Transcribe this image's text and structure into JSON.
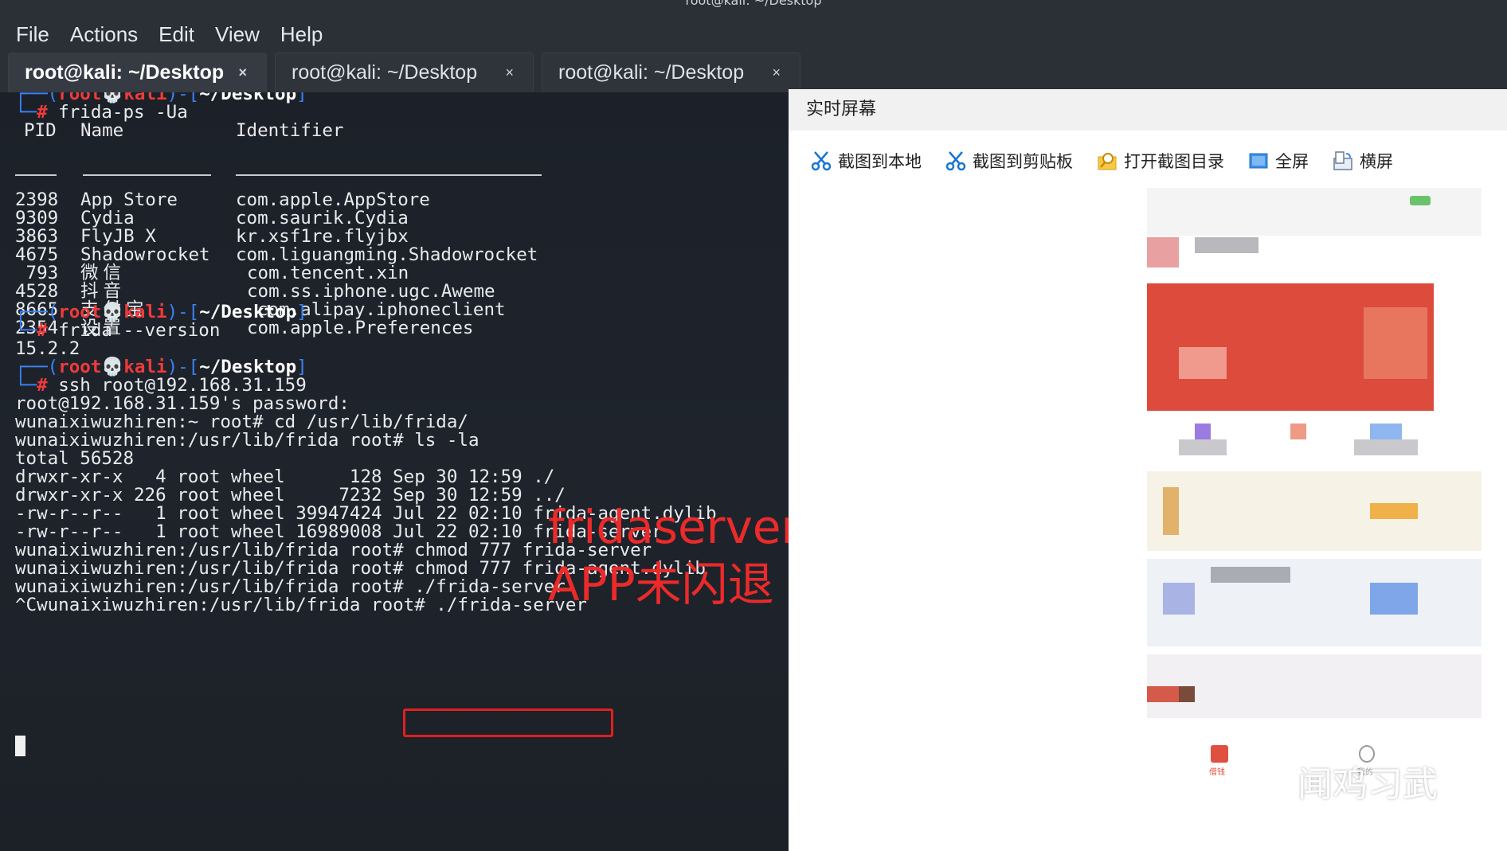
{
  "window": {
    "title": "root@kali: ~/Desktop"
  },
  "menu": [
    "File",
    "Actions",
    "Edit",
    "View",
    "Help"
  ],
  "tabs": [
    {
      "label": "root@kali: ~/Desktop",
      "close": "×"
    },
    {
      "label": "root@kali: ~/Desktop",
      "close": "×"
    },
    {
      "label": "root@kali: ~/Desktop",
      "close": "×"
    }
  ],
  "terminal": {
    "prompt": {
      "user": "root",
      "host": "kali",
      "path": "~/Desktop"
    },
    "cmd1": "frida-ps -Ua",
    "table_headers": {
      "pid": "PID",
      "name": "Name",
      "identifier": "Identifier"
    },
    "processes": [
      {
        "pid": "2398",
        "name": "App Store",
        "id": "com.apple.AppStore"
      },
      {
        "pid": "9309",
        "name": "Cydia",
        "id": "com.saurik.Cydia"
      },
      {
        "pid": "3863",
        "name": "FlyJB X",
        "id": "kr.xsf1re.flyjbx"
      },
      {
        "pid": "4675",
        "name": "Shadowrocket",
        "id": "com.liguangming.Shadowrocket"
      },
      {
        "pid": " 793",
        "name": "微信",
        "id": "com.tencent.xin"
      },
      {
        "pid": "4528",
        "name": "抖音",
        "id": "com.ss.iphone.ugc.Aweme"
      },
      {
        "pid": "8665",
        "name": "支付宝",
        "id": "com.alipay.iphoneclient"
      },
      {
        "pid": "2354",
        "name": "设置",
        "id": "com.apple.Preferences"
      }
    ],
    "cmd2": "frida --version",
    "version": "15.2.2",
    "cmd3": "ssh root@192.168.31.159",
    "lines": [
      "root@192.168.31.159's password:",
      "wunaixiwuzhiren:~ root# cd /usr/lib/frida/",
      "wunaixiwuzhiren:/usr/lib/frida root# ls -la",
      "total 56528",
      "drwxr-xr-x   4 root wheel      128 Sep 30 12:59 ./",
      "drwxr-xr-x 226 root wheel     7232 Sep 30 12:59 ../",
      "-rw-r--r--   1 root wheel 39947424 Jul 22 02:10 frida-agent.dylib",
      "-rw-r--r--   1 root wheel 16989008 Jul 22 02:10 frida-server",
      "wunaixiwuzhiren:/usr/lib/frida root# chmod 777 frida-server",
      "wunaixiwuzhiren:/usr/lib/frida root# chmod 777 frida-agent.dylib",
      "wunaixiwuzhiren:/usr/lib/frida root# ./frida-server",
      "^Cwunaixiwuzhiren:/usr/lib/frida root# ./frida-server"
    ],
    "annotation": "fridaserver运行\nAPP未闪退"
  },
  "mirror": {
    "title": "实时屏幕",
    "toolbar": [
      "截图到本地",
      "截图到剪贴板",
      "打开截图目录",
      "全屏",
      "横屏"
    ],
    "phone_nav": [
      "借钱",
      "我的"
    ],
    "watermark": "闻鸡习武"
  }
}
